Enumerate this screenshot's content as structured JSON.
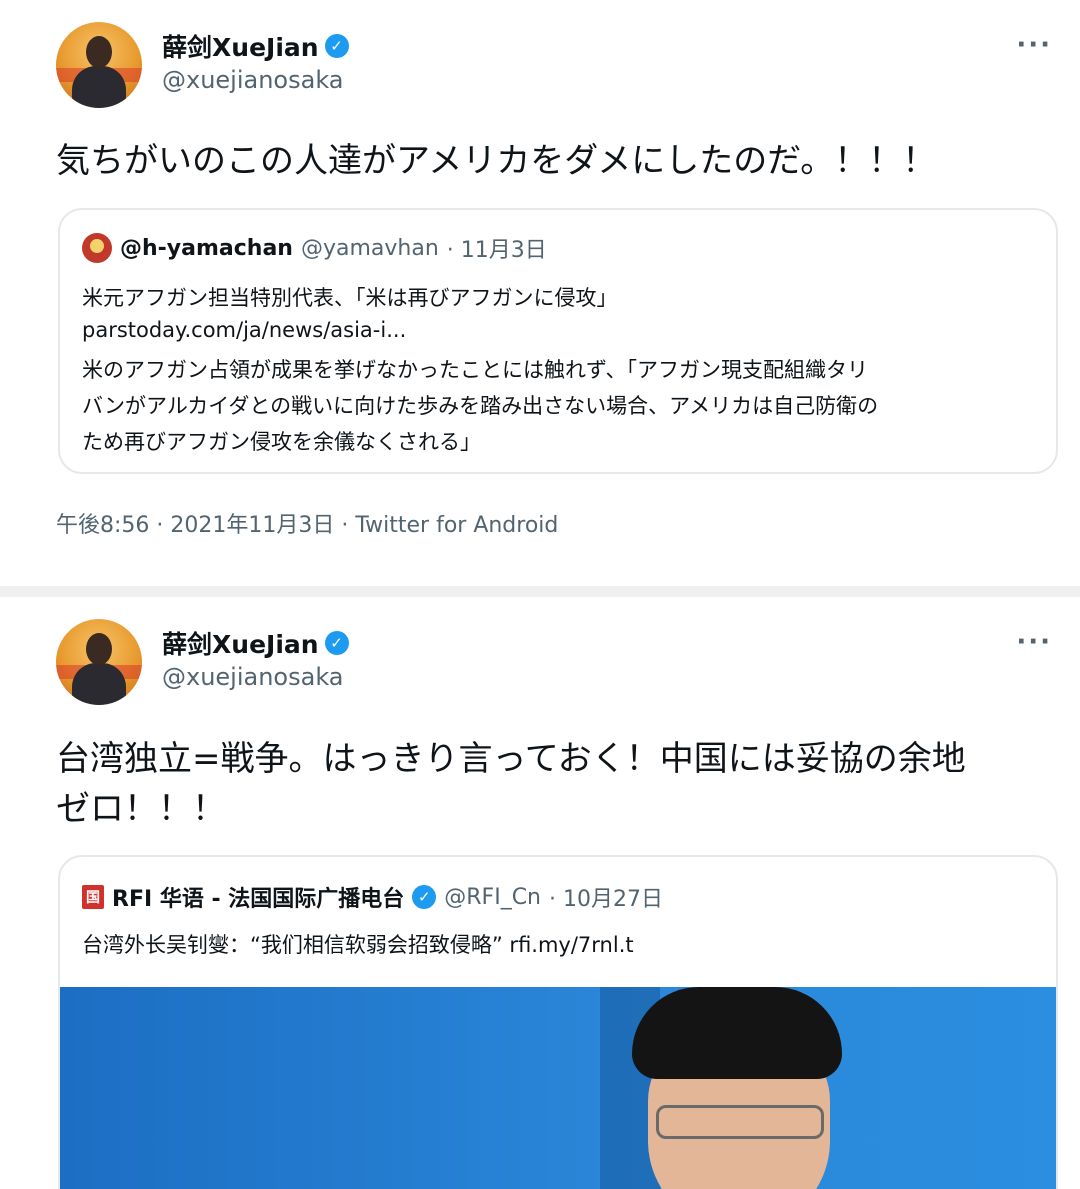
{
  "tweets": [
    {
      "author_name": "薛剑XueJian",
      "author_handle": "@xuejianosaka",
      "more_label": "···",
      "verified_mark": "✓",
      "text": "気ちがいのこの人達がアメリカをダメにしたのだ。！！！",
      "quote": {
        "name": "@h-yamachan",
        "handle": "@yamavhan",
        "date": "· 11月3日",
        "lines": [
          "米元アフガン担当特別代表、「米は再びアフガンに侵攻」",
          "parstoday.com/ja/news/asia-i...",
          "米のアフガン占領が成果を挙げなかったことには触れず、「アフガン現支配組織タリ",
          "バンがアルカイダとの戦いに向けた歩みを踏み出さない場合、アメリカは自己防衛の",
          "ため再びアフガン侵攻を余儀なくされる」"
        ]
      },
      "meta": "午後8:56 · 2021年11月3日 · Twitter for Android"
    },
    {
      "author_name": "薛剑XueJian",
      "author_handle": "@xuejianosaka",
      "more_label": "···",
      "verified_mark": "✓",
      "text_line1": "台湾独立=戦争。はっきり言っておく！中国には妥協の余地",
      "text_line2": "ゼロ！！！",
      "quote": {
        "icon_glyph": "国",
        "name": "RFI 华语 - 法国国际广播电台",
        "verified_mark": "✓",
        "handle": "@RFI_Cn",
        "date": "· 10月27日",
        "line": "台湾外长吴钊燮：“我们相信软弱会招致侵略” rfi.my/7rnl.t"
      }
    }
  ],
  "colors": {
    "verified_blue": "#1d9bf0",
    "secondary_text": "#536471",
    "primary_text": "#0f1419",
    "separator": "#eef0f2",
    "photo_blue": "#2a86d8"
  },
  "icons": [
    "verified-badge-icon",
    "more-options-icon",
    "quoted-avatar",
    "rfi-logo-icon",
    "avatar"
  ]
}
